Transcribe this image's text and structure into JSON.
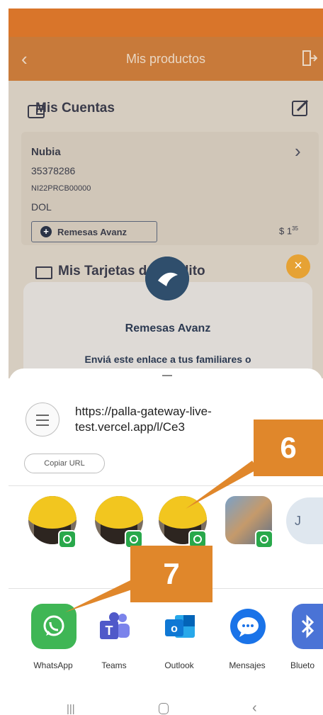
{
  "header": {
    "title": "Mis productos"
  },
  "accounts": {
    "title": "Mis Cuentas",
    "name": "Nubia",
    "number": "35378286",
    "iban": "NI22PRCB00000",
    "currency": "DOL",
    "remesas_button": "Remesas Avanz",
    "balance": "$ 1",
    "balance_cents": "35"
  },
  "cards": {
    "title": "Mis Tarjetas de Crédito"
  },
  "popup": {
    "title": "Remesas Avanz",
    "text": "Enviá este enlace a tus familiares o"
  },
  "share": {
    "url": "https://palla-gateway-live-test.vercel.app/l/Ce3",
    "copy_label": "Copiar URL",
    "contact_j": "J",
    "apps": [
      {
        "label": "WhatsApp",
        "icon": "whatsapp-icon",
        "color": "#3fb655"
      },
      {
        "label": "Teams",
        "icon": "teams-icon",
        "color": "#5059c9"
      },
      {
        "label": "Outlook",
        "icon": "outlook-icon",
        "color": "#0f78d4"
      },
      {
        "label": "Mensajes",
        "icon": "messages-icon",
        "color": "#1a73e8"
      },
      {
        "label": "Blueto",
        "icon": "bluetooth-icon",
        "color": "#4a73d6"
      }
    ]
  },
  "callouts": {
    "six": "6",
    "seven": "7"
  },
  "colors": {
    "accent": "#e0872b",
    "header": "#c87a3a",
    "whatsapp": "#29a84b"
  }
}
